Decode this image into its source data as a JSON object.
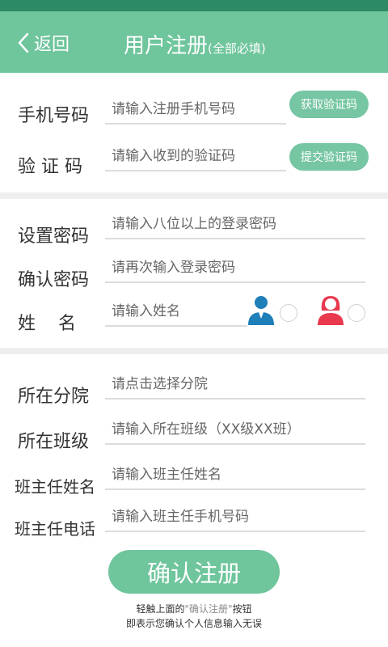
{
  "header": {
    "back_label": "返回",
    "title": "用户注册",
    "title_note": "(全部必填)"
  },
  "form": {
    "phone": {
      "label": "手机号码",
      "placeholder": "请输入注册手机号码",
      "button": "获取验证码"
    },
    "code": {
      "label": "验 证 码",
      "placeholder": "请输入收到的验证码",
      "button": "提交验证码"
    },
    "password": {
      "label": "设置密码",
      "placeholder": "请输入八位以上的登录密码"
    },
    "confirm_password": {
      "label": "确认密码",
      "placeholder": "请再次输入登录密码"
    },
    "name": {
      "label": "姓    名",
      "placeholder": "请输入姓名"
    },
    "branch": {
      "label": "所在分院",
      "placeholder": "请点击选择分院"
    },
    "class": {
      "label": "所在班级",
      "placeholder": "请输入所在班级（XX级XX班）"
    },
    "teacher_name": {
      "label": "班主任姓名",
      "placeholder": "请输入班主任姓名"
    },
    "teacher_phone": {
      "label": "班主任电话",
      "placeholder": "请输入班主任手机号码"
    }
  },
  "gender": {
    "male_icon": "male-user-icon",
    "female_icon": "female-user-icon"
  },
  "submit_label": "确认注册",
  "notice": {
    "prefix": "轻触上面的",
    "highlight": "\"确认注册\"",
    "suffix": "按钮",
    "line2": "即表示您确认个人信息输入无误"
  },
  "colors": {
    "header": "#6fc59c",
    "statusbar": "#2d8a66",
    "button": "#76c6a3",
    "male": "#1f7fb8",
    "female": "#e8394e"
  }
}
